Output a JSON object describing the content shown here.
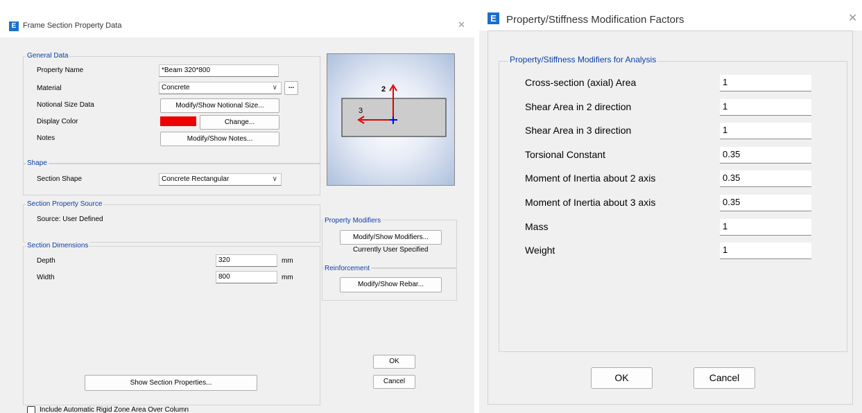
{
  "left_dialog": {
    "title": "Frame Section Property Data",
    "general_data": {
      "group_label": "General Data",
      "property_name_label": "Property Name",
      "property_name_value": "*Beam 320*800",
      "material_label": "Material",
      "material_value": "Concrete",
      "material_more_button": "...",
      "notional_size_label": "Notional Size Data",
      "notional_size_button": "Modify/Show Notional Size...",
      "display_color_label": "Display Color",
      "display_color": "#ee0000",
      "change_color_button": "Change...",
      "notes_label": "Notes",
      "notes_button": "Modify/Show Notes..."
    },
    "shape": {
      "group_label": "Shape",
      "section_shape_label": "Section Shape",
      "section_shape_value": "Concrete Rectangular"
    },
    "section_property_source": {
      "group_label": "Section Property Source",
      "source_text": "Source:  User Defined"
    },
    "section_dimensions": {
      "group_label": "Section Dimensions",
      "depth_label": "Depth",
      "depth_value": "320",
      "depth_unit": "mm",
      "width_label": "Width",
      "width_value": "800",
      "width_unit": "mm"
    },
    "preview": {
      "axis_2_label": "2",
      "axis_3_label": "3"
    },
    "property_modifiers": {
      "group_label": "Property Modifiers",
      "button": "Modify/Show Modifiers...",
      "status": "Currently User Specified"
    },
    "reinforcement": {
      "group_label": "Reinforcement",
      "button": "Modify/Show Rebar..."
    },
    "ok_button": "OK",
    "cancel_button": "Cancel",
    "show_section_properties_button": "Show Section Properties...",
    "rigid_zone_checkbox_label": "Include Automatic Rigid Zone Area Over Column"
  },
  "right_dialog": {
    "title": "Property/Stiffness Modification Factors",
    "group_label": "Property/Stiffness Modifiers for Analysis",
    "modifiers": [
      {
        "label": "Cross-section (axial) Area",
        "value": "1"
      },
      {
        "label": "Shear Area in 2 direction",
        "value": "1"
      },
      {
        "label": "Shear Area in 3 direction",
        "value": "1"
      },
      {
        "label": "Torsional Constant",
        "value": "0.35"
      },
      {
        "label": "Moment of Inertia about 2 axis",
        "value": "0.35"
      },
      {
        "label": "Moment of Inertia about 3 axis",
        "value": "0.35"
      },
      {
        "label": "Mass",
        "value": "1"
      },
      {
        "label": "Weight",
        "value": "1"
      }
    ],
    "ok_button": "OK",
    "cancel_button": "Cancel"
  },
  "app_icon_letter": "E",
  "close_glyph": "✕",
  "colors": {
    "accent_blue": "#0a3ea8",
    "icon_blue": "#1a6fd1",
    "axis_red": "#e00000",
    "axis_blue": "#0000ff"
  }
}
